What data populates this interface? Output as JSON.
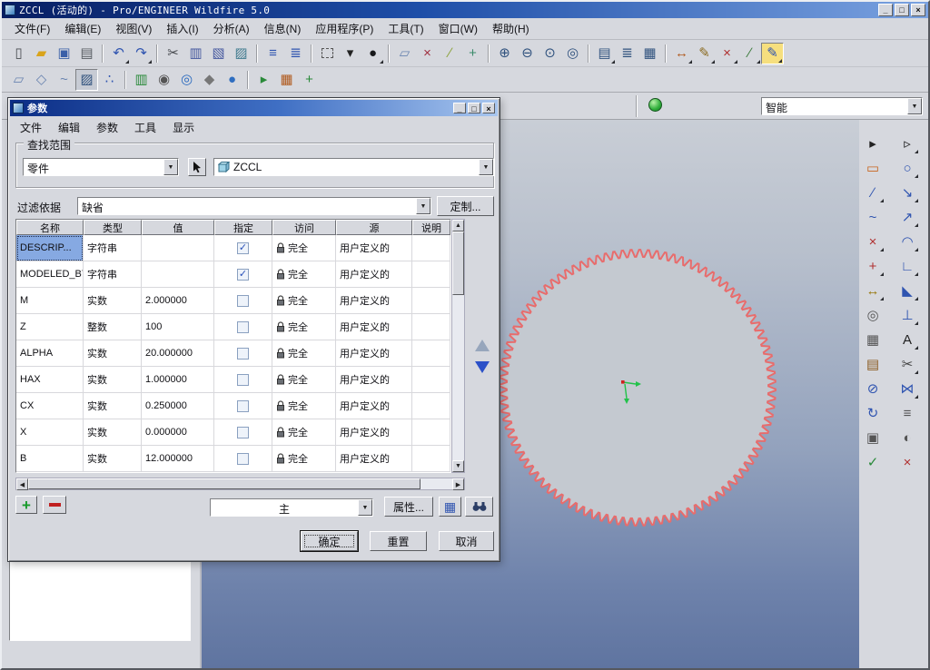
{
  "window": {
    "title": "ZCCL (活动的) - Pro/ENGINEER Wildfire 5.0",
    "minimize": "_",
    "maximize": "□",
    "close": "×"
  },
  "menubar": {
    "items": [
      "文件(F)",
      "编辑(E)",
      "视图(V)",
      "插入(I)",
      "分析(A)",
      "信息(N)",
      "应用程序(P)",
      "工具(T)",
      "窗口(W)",
      "帮助(H)"
    ]
  },
  "toolbars": {
    "main": [
      {
        "n": "new-file-icon",
        "g": "▯",
        "c": "#4a4d52"
      },
      {
        "n": "open-folder-icon",
        "g": "▰",
        "c": "#d9a41c"
      },
      {
        "n": "save-icon",
        "g": "▣",
        "c": "#3a5fa8"
      },
      {
        "n": "print-icon",
        "g": "▤",
        "c": "#565a60"
      },
      {
        "sep": true
      },
      {
        "n": "undo-icon",
        "g": "↶",
        "c": "#2f54b0",
        "a": true
      },
      {
        "n": "redo-icon",
        "g": "↷",
        "c": "#2f54b0",
        "a": true
      },
      {
        "sep": true
      },
      {
        "n": "cut-icon",
        "g": "✂",
        "c": "#44474c"
      },
      {
        "n": "copy-icon",
        "g": "▥",
        "c": "#44579e"
      },
      {
        "n": "paste-icon",
        "g": "▧",
        "c": "#44579e"
      },
      {
        "n": "paste-special-icon",
        "g": "▨",
        "c": "#3f7a8e"
      },
      {
        "sep": true
      },
      {
        "n": "regenerate-icon",
        "g": "≡",
        "c": "#2f54b0"
      },
      {
        "n": "auto-regenerate-icon",
        "g": "≣",
        "c": "#2f54b0"
      },
      {
        "sep": true
      },
      {
        "n": "select-box-icon",
        "box": true
      },
      {
        "n": "toolbar-overflow-icon",
        "g": "▾",
        "c": "#222"
      },
      {
        "n": "render-style-icon",
        "g": "●",
        "c": "#17181a",
        "a": true
      },
      {
        "sep": true
      },
      {
        "n": "datum-plane-toggle-icon",
        "g": "▱",
        "c": "#6a84b0"
      },
      {
        "n": "datum-point-toggle-icon",
        "g": "×",
        "c": "#a03040"
      },
      {
        "n": "datum-axis-toggle-icon",
        "g": "∕",
        "c": "#8aa23a"
      },
      {
        "n": "csys-toggle-icon",
        "g": "+",
        "c": "#3a8a6a"
      },
      {
        "sep": true
      },
      {
        "n": "zoom-in-icon",
        "g": "⊕",
        "c": "#30527e"
      },
      {
        "n": "zoom-out-icon",
        "g": "⊖",
        "c": "#30527e"
      },
      {
        "n": "refit-icon",
        "g": "⊙",
        "c": "#30527e"
      },
      {
        "n": "reorient-icon",
        "g": "◎",
        "c": "#30527e"
      },
      {
        "sep": true
      },
      {
        "n": "saved-views-icon",
        "g": "▤",
        "c": "#30527e",
        "a": true
      },
      {
        "n": "layers-icon",
        "g": "≣",
        "c": "#30527e"
      },
      {
        "n": "view-manager-icon",
        "g": "▦",
        "c": "#30527e"
      },
      {
        "sep": true
      },
      {
        "n": "dimension-tool-icon",
        "g": "↔",
        "c": "#b05a1e",
        "a": true
      },
      {
        "n": "note-tool-icon",
        "g": "✎",
        "c": "#8a6a20",
        "a": true
      },
      {
        "n": "point-tool-icon",
        "g": "×",
        "c": "#b03030",
        "a": true
      },
      {
        "n": "axis-tool-icon",
        "g": "∕",
        "c": "#3a7a3a",
        "a": true
      },
      {
        "n": "sketch-tool-icon",
        "g": "✎",
        "c": "#2f54b0",
        "p": true,
        "y": true,
        "a": true
      }
    ],
    "datum": [
      {
        "n": "datum-plane-icon",
        "g": "▱",
        "c": "#6a84b0"
      },
      {
        "n": "datum-axis-icon",
        "g": "◇",
        "c": "#6a84b0"
      },
      {
        "n": "datum-curve-icon",
        "g": "~",
        "c": "#6a84b0"
      },
      {
        "n": "sketch-icon",
        "g": "▨",
        "c": "#30527e",
        "p": true
      },
      {
        "n": "datum-point-icon",
        "g": "∴",
        "c": "#2f54b0"
      },
      {
        "sep": true
      },
      {
        "n": "analysis-icon",
        "g": "▥",
        "c": "#2a8a3a"
      },
      {
        "n": "model-player-icon",
        "g": "◉",
        "c": "#555"
      },
      {
        "n": "web-browser-icon",
        "g": "◎",
        "c": "#2a6abf"
      },
      {
        "n": "materials-icon",
        "g": "◆",
        "c": "#777"
      },
      {
        "n": "earth-icon",
        "g": "●",
        "c": "#2f6ec0"
      },
      {
        "sep": true
      },
      {
        "n": "mapkey-play-icon",
        "g": "▸",
        "c": "#2a8a3a"
      },
      {
        "n": "palette-icon",
        "g": "▦",
        "c": "#b05a1e"
      },
      {
        "n": "spin-center-icon",
        "g": "+",
        "c": "#2a8a3a"
      }
    ]
  },
  "filter_bar": {
    "selector_value": "智能"
  },
  "right_toolbar": [
    {
      "n": "select-icon",
      "g": "▸",
      "c": "#222"
    },
    {
      "n": "select-mode-icon",
      "g": "▹",
      "c": "#222",
      "a": true
    },
    {
      "n": "rectangle-icon",
      "g": "▭",
      "c": "#c8641c"
    },
    {
      "n": "circle-icon",
      "g": "○",
      "c": "#2f54b0",
      "a": true
    },
    {
      "n": "line-icon",
      "g": "∕",
      "c": "#2f54b0",
      "a": true
    },
    {
      "n": "use-edge-icon",
      "g": "↘",
      "c": "#2f54b0",
      "a": true
    },
    {
      "n": "spline-icon",
      "g": "~",
      "c": "#2f54b0"
    },
    {
      "n": "offset-edge-icon",
      "g": "↗",
      "c": "#2f54b0",
      "a": true
    },
    {
      "n": "point-icon",
      "g": "×",
      "c": "#b03030",
      "a": true
    },
    {
      "n": "arc-icon",
      "g": "◠",
      "c": "#2f54b0",
      "a": true
    },
    {
      "n": "csys-point-icon",
      "g": "+",
      "c": "#b03030",
      "a": true
    },
    {
      "n": "fillet-icon",
      "g": "∟",
      "c": "#2f54b0",
      "a": true
    },
    {
      "n": "dimension-icon",
      "g": "↔",
      "c": "#9a7a10",
      "a": true
    },
    {
      "n": "chamfer-icon",
      "g": "◣",
      "c": "#2f54b0",
      "a": true
    },
    {
      "n": "modify-icon",
      "g": "◎",
      "c": "#555"
    },
    {
      "n": "constraint-icon",
      "g": "⊥",
      "c": "#2f54b0",
      "a": true
    },
    {
      "n": "grid-icon",
      "g": "▦",
      "c": "#555"
    },
    {
      "n": "text-icon",
      "g": "A",
      "c": "#222",
      "a": true
    },
    {
      "n": "sketcher-palette-icon",
      "g": "▤",
      "c": "#8a5a20"
    },
    {
      "n": "trim-icon",
      "g": "✂",
      "c": "#444",
      "a": true
    },
    {
      "n": "divide-icon",
      "g": "⊘",
      "c": "#2f54b0"
    },
    {
      "n": "mirror-icon",
      "g": "⋈",
      "c": "#2f54b0",
      "a": true
    },
    {
      "n": "rotate-resize-icon",
      "g": "↻",
      "c": "#2f54b0"
    },
    {
      "n": "thicken-icon",
      "g": "≡",
      "c": "#555"
    },
    {
      "n": "close-section-icon",
      "g": "▣",
      "c": "#555"
    },
    {
      "n": "shade-section-icon",
      "g": "◐",
      "c": "#555"
    },
    {
      "n": "done-icon",
      "g": "✓",
      "c": "#2a8a3a"
    },
    {
      "n": "quit-icon",
      "g": "×",
      "c": "#b03030"
    }
  ],
  "dialog": {
    "title": "参数",
    "minimize": "_",
    "maximize": "□",
    "close": "×",
    "menu": [
      "文件",
      "编辑",
      "参数",
      "工具",
      "显示"
    ],
    "look_in": {
      "label": "查找范围",
      "type_value": "零件",
      "model_value": "ZCCL"
    },
    "filter": {
      "label": "过滤依据",
      "value": "缺省",
      "customize_label": "定制..."
    },
    "table": {
      "columns": [
        "名称",
        "类型",
        "值",
        "指定",
        "访问",
        "源",
        "说明"
      ],
      "rows": [
        {
          "name": "DESCRIP...",
          "type": "字符串",
          "value": "",
          "designate": true,
          "access": "完全",
          "source": "用户定义的",
          "desc": "",
          "selected": true
        },
        {
          "name": "MODELED_BY",
          "type": "字符串",
          "value": "",
          "designate": true,
          "access": "完全",
          "source": "用户定义的",
          "desc": ""
        },
        {
          "name": "M",
          "type": "实数",
          "value": "2.000000",
          "designate": false,
          "access": "完全",
          "source": "用户定义的",
          "desc": ""
        },
        {
          "name": "Z",
          "type": "整数",
          "value": "100",
          "designate": false,
          "access": "完全",
          "source": "用户定义的",
          "desc": ""
        },
        {
          "name": "ALPHA",
          "type": "实数",
          "value": "20.000000",
          "designate": false,
          "access": "完全",
          "source": "用户定义的",
          "desc": ""
        },
        {
          "name": "HAX",
          "type": "实数",
          "value": "1.000000",
          "designate": false,
          "access": "完全",
          "source": "用户定义的",
          "desc": ""
        },
        {
          "name": "CX",
          "type": "实数",
          "value": "0.250000",
          "designate": false,
          "access": "完全",
          "source": "用户定义的",
          "desc": ""
        },
        {
          "name": "X",
          "type": "实数",
          "value": "0.000000",
          "designate": false,
          "access": "完全",
          "source": "用户定义的",
          "desc": ""
        },
        {
          "name": "B",
          "type": "实数",
          "value": "12.000000",
          "designate": false,
          "access": "完全",
          "source": "用户定义的",
          "desc": ""
        }
      ]
    },
    "footer": {
      "group_value": "主",
      "properties_label": "属性...",
      "ok": "确定",
      "reset": "重置",
      "cancel": "取消"
    }
  },
  "graphics": {
    "gear": {
      "teeth": 100,
      "stroke": "#e86c6c",
      "fill": "#c4c9d0"
    }
  }
}
